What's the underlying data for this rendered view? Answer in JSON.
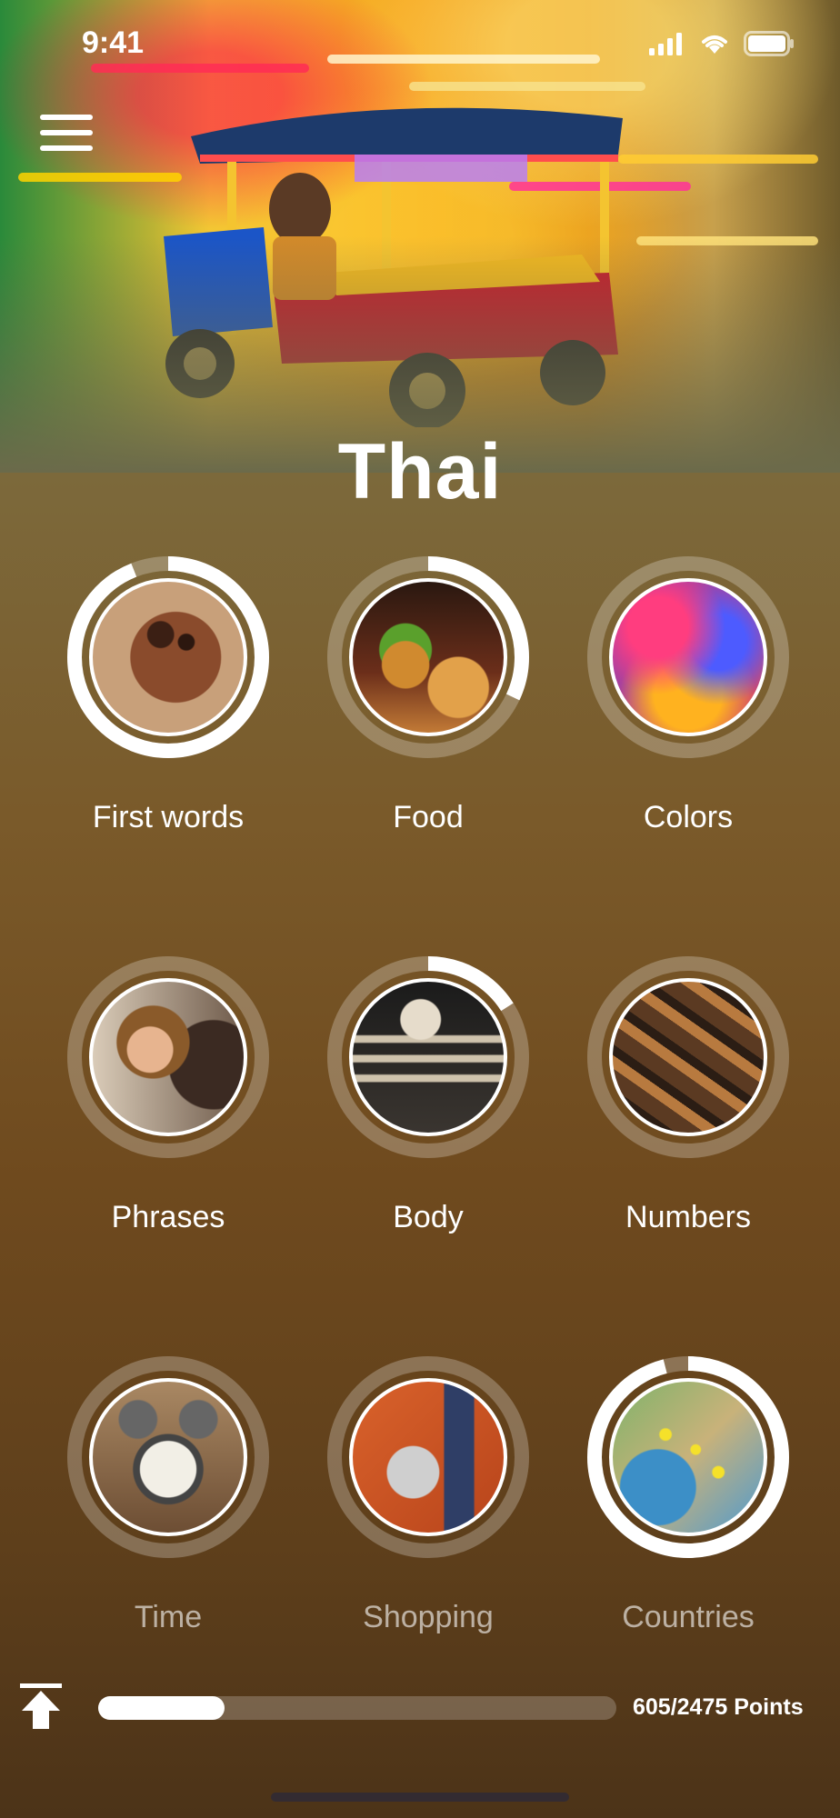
{
  "status_bar": {
    "time": "9:41"
  },
  "app": {
    "title": "Thai"
  },
  "lessons": [
    {
      "label": "First words",
      "progress": 0.94,
      "icon": "baby-face-photo",
      "dim": false
    },
    {
      "label": "Food",
      "progress": 0.32,
      "icon": "burger-fries-photo",
      "dim": false
    },
    {
      "label": "Colors",
      "progress": 0.0,
      "icon": "color-powder-photo",
      "dim": false
    },
    {
      "label": "Phrases",
      "progress": 0.0,
      "icon": "people-talking-photo",
      "dim": false
    },
    {
      "label": "Body",
      "progress": 0.16,
      "icon": "skeleton-photo",
      "dim": false
    },
    {
      "label": "Numbers",
      "progress": 0.0,
      "icon": "wooden-numbers-photo",
      "dim": false
    },
    {
      "label": "Time",
      "progress": 0.0,
      "icon": "alarm-clock-photo",
      "dim": true
    },
    {
      "label": "Shopping",
      "progress": 0.0,
      "icon": "shopping-cart-photo",
      "dim": true
    },
    {
      "label": "Countries",
      "progress": 0.96,
      "icon": "map-pins-photo",
      "dim": true
    }
  ],
  "footer": {
    "points_text": "605/2475 Points",
    "progress": 0.244
  },
  "colors": {
    "ring_track": "rgba(255,255,255,0.25)",
    "ring_fill": "#ffffff"
  }
}
